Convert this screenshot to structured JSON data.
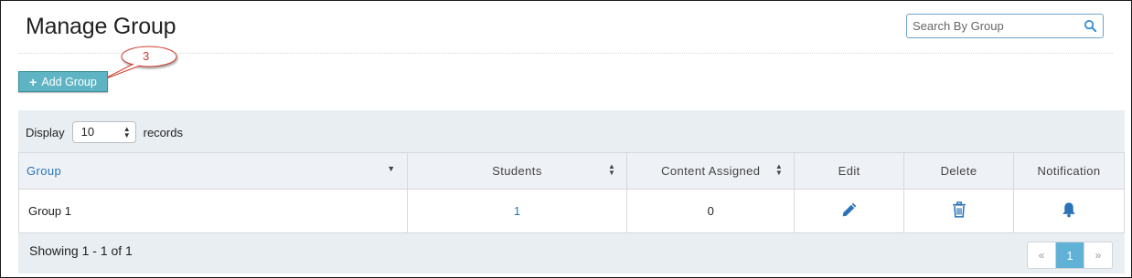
{
  "page": {
    "title": "Manage Group"
  },
  "search": {
    "placeholder": "Search By Group"
  },
  "toolbar": {
    "add_label": "Add Group",
    "callout_number": "3"
  },
  "display": {
    "prefix": "Display",
    "value": "10",
    "suffix": "records"
  },
  "table": {
    "headers": [
      "Group",
      "Students",
      "Content Assigned",
      "Edit",
      "Delete",
      "Notification"
    ],
    "rows": [
      {
        "group": "Group 1",
        "students": "1",
        "content_assigned": "0"
      }
    ]
  },
  "footer": {
    "showing": "Showing 1 - 1 of 1"
  },
  "pagination": {
    "prev": "«",
    "current": "1",
    "next": "»"
  },
  "colors": {
    "accent": "#5fb4c3",
    "link": "#2a73b8",
    "callout": "#d03a2a",
    "pager_active": "#5fb2d6"
  }
}
